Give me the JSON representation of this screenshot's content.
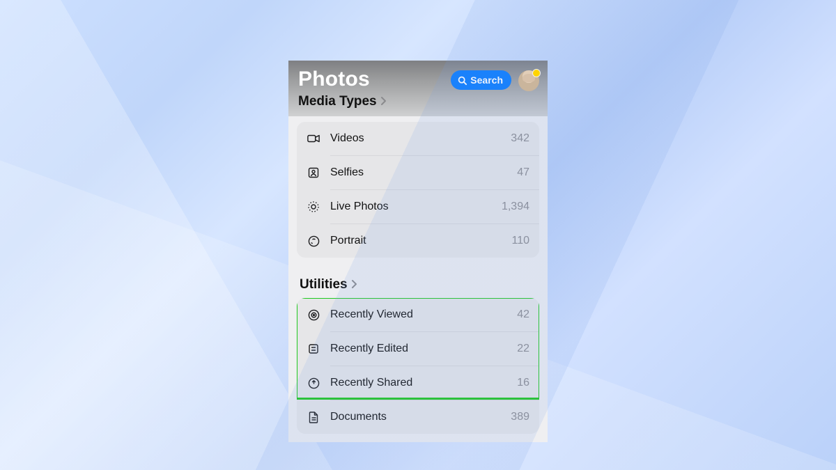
{
  "header": {
    "app_title": "Photos",
    "section_title": "Media Types",
    "search_label": "Search"
  },
  "media_types": [
    {
      "icon": "video",
      "label": "Videos",
      "count": "342"
    },
    {
      "icon": "selfie",
      "label": "Selfies",
      "count": "47"
    },
    {
      "icon": "live",
      "label": "Live Photos",
      "count": "1,394"
    },
    {
      "icon": "portrait",
      "label": "Portrait",
      "count": "110"
    }
  ],
  "utilities_title": "Utilities",
  "utilities": [
    {
      "icon": "eye",
      "label": "Recently Viewed",
      "count": "42"
    },
    {
      "icon": "edit",
      "label": "Recently Edited",
      "count": "22"
    },
    {
      "icon": "share",
      "label": "Recently Shared",
      "count": "16"
    },
    {
      "icon": "document",
      "label": "Documents",
      "count": "389"
    }
  ],
  "highlight": {
    "color": "#1ec81e",
    "rows": [
      0,
      1,
      2
    ]
  }
}
